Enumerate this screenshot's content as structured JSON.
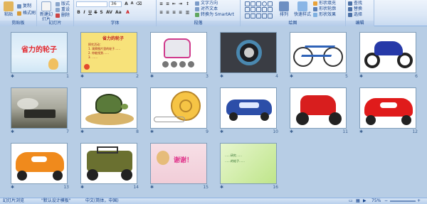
{
  "ribbon": {
    "groups": {
      "clipboard": "剪贴板",
      "slides": "幻灯片",
      "font": "字体",
      "paragraph": "段落",
      "drawing": "绘图",
      "editing": "编辑"
    },
    "paste_label": "粘贴",
    "copy_label": "复制",
    "format_painter_label": "格式刷",
    "new_slide_label": "新建幻灯片",
    "layout_label": "版式",
    "reset_label": "重设",
    "delete_label": "删除",
    "font_size": "36",
    "text_direction_label": "文字方向",
    "align_text_label": "对齐文本",
    "smartart_label": "转换为 SmartArt",
    "arrange_label": "排列",
    "quick_styles_label": "快速样式",
    "shape_fill_label": "形状填充",
    "shape_outline_label": "形状轮廓",
    "shape_effects_label": "形状效果",
    "find_label": "查找",
    "replace_label": "替换",
    "select_label": "选择"
  },
  "slides": [
    {
      "num": "1",
      "title": "省力的轮子",
      "kind": "title"
    },
    {
      "num": "2",
      "title": "省力的轮子",
      "kind": "text",
      "lines": [
        "探究活动：",
        "1. 观察图片里的轮子……",
        "2. 你能找到……",
        "3. ……"
      ]
    },
    {
      "num": "3",
      "kind": "rollerskate"
    },
    {
      "num": "4",
      "kind": "tape"
    },
    {
      "num": "5",
      "kind": "bicycle"
    },
    {
      "num": "6",
      "kind": "motorbike"
    },
    {
      "num": "7",
      "kind": "train"
    },
    {
      "num": "8",
      "kind": "turtle"
    },
    {
      "num": "9",
      "kind": "snail"
    },
    {
      "num": "10",
      "kind": "car-blue"
    },
    {
      "num": "11",
      "kind": "toy-motorbike"
    },
    {
      "num": "12",
      "kind": "toy-car-red"
    },
    {
      "num": "13",
      "kind": "toy-car-orange"
    },
    {
      "num": "14",
      "kind": "toy-jeep"
    },
    {
      "num": "15",
      "title": "谢谢！",
      "kind": "thanks"
    },
    {
      "num": "16",
      "kind": "green",
      "lines": [
        "……研究……",
        "……的轮子……"
      ]
    }
  ],
  "status": {
    "view": "幻灯片浏览",
    "theme": "\"默认设计模板\"",
    "language": "中文(简体，中国)",
    "zoom": "75%"
  },
  "colors": {
    "ribbon_border": "#8db2e3",
    "background": "#b7cde5",
    "title_red": "#e3272d"
  }
}
